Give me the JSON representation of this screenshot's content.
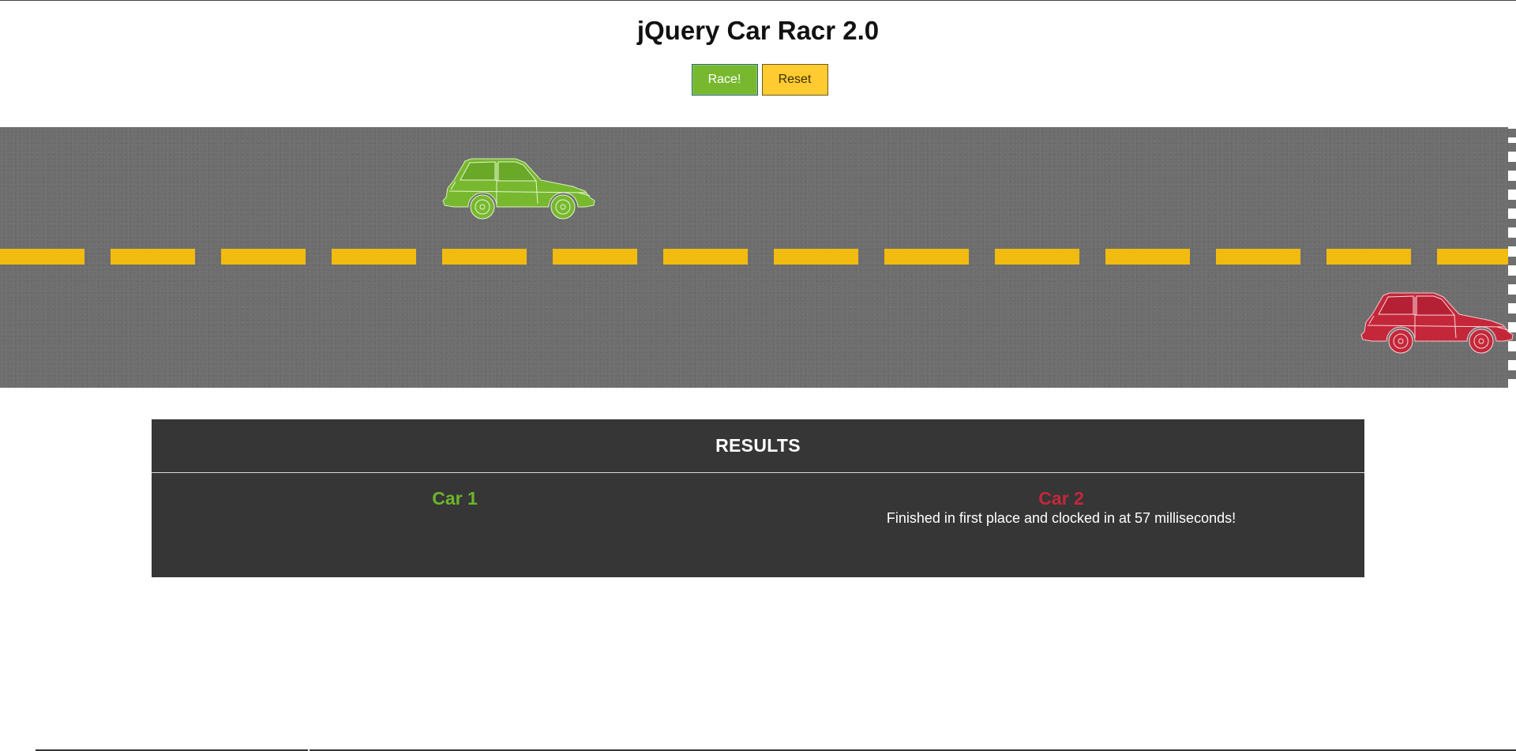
{
  "page": {
    "title": "jQuery Car Racr 2.0"
  },
  "controls": {
    "race_label": "Race!",
    "reset_label": "Reset"
  },
  "cars": [
    {
      "name": "Car 1",
      "color": "#77b82f",
      "icon": "hatchback-car-icon"
    },
    {
      "name": "Car 2",
      "color": "#c4273a",
      "icon": "hatchback-car-icon"
    }
  ],
  "colors": {
    "road": "#6e6e6e",
    "lane_marking": "#f2bb0f",
    "results_bg": "#363636",
    "race_button": "#77b82f",
    "reset_button": "#ffcb30"
  },
  "results": {
    "header": "RESULTS",
    "car1": {
      "name": "Car 1",
      "message": ""
    },
    "car2": {
      "name": "Car 2",
      "message": "Finished in first place and clocked in at 57 milliseconds!"
    }
  }
}
